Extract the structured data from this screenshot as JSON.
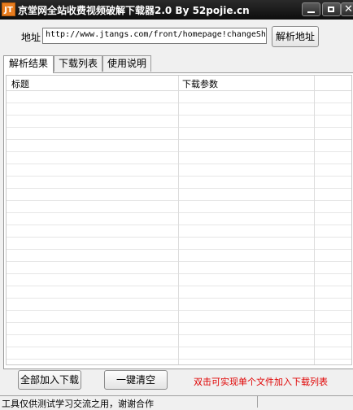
{
  "window": {
    "icon_text": "JT",
    "title": "京堂网全站收费视频破解下载器2.0 By 52pojie.cn"
  },
  "address": {
    "label": "地址",
    "value": "http://www.jtangs.com/front/homepage!changeShowSellWay",
    "parse_button": "解析地址"
  },
  "tabs": [
    {
      "label": "解析结果",
      "active": true
    },
    {
      "label": "下载列表",
      "active": false
    },
    {
      "label": "使用说明",
      "active": false
    }
  ],
  "grid": {
    "columns": [
      "标题",
      "下载参数"
    ],
    "rows": []
  },
  "actions": {
    "add_all": "全部加入下载",
    "clear_all": "一键清空",
    "hint": "双击可实现单个文件加入下载列表",
    "hint_color": "#e00000"
  },
  "status": {
    "text": "工具仅供测试学习交流之用，谢谢合作"
  }
}
